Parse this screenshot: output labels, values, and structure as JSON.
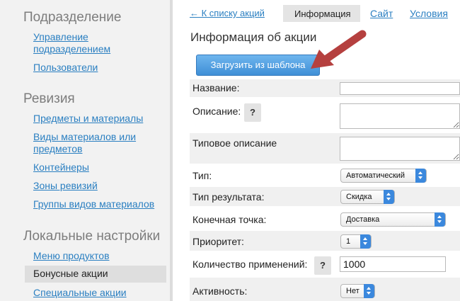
{
  "sidebar": {
    "sections": [
      {
        "title": "Подразделение",
        "items": [
          "Управление подразделением",
          "Пользователи"
        ]
      },
      {
        "title": "Ревизия",
        "items": [
          "Предметы и материалы",
          "Виды материалов или предметов",
          "Контейнеры",
          "Зоны ревизий",
          "Группы видов материалов"
        ]
      },
      {
        "title": "Локальные настройки",
        "items": [
          "Меню продуктов",
          "Бонусные акции",
          "Специальные акции"
        ]
      }
    ],
    "active_item": "Бонусные акции"
  },
  "tabs": {
    "back": "← К списку акций",
    "info": "Информация",
    "site": "Сайт",
    "conditions": "Условия"
  },
  "page_title": "Информация об акции",
  "template_button": "Загрузить из шаблона",
  "form": {
    "name_label": "Название:",
    "name_value": "",
    "description_label": "Описание:",
    "help_glyph": "?",
    "typical_description_label": "Типовое описание",
    "type_label": "Тип:",
    "type_value": "Автоматический",
    "result_type_label": "Тип результата:",
    "result_type_value": "Скидка",
    "endpoint_label": "Конечная точка:",
    "endpoint_value": "Доставка",
    "priority_label": "Приоритет:",
    "priority_value": "1",
    "usage_count_label": "Количество применений:",
    "usage_count_value": "1000",
    "active_label": "Активность:",
    "active_value": "Нет"
  },
  "colors": {
    "link": "#2a7fc1",
    "accent_button": "#4f9fe3",
    "annotation_arrow": "#b5403f"
  }
}
